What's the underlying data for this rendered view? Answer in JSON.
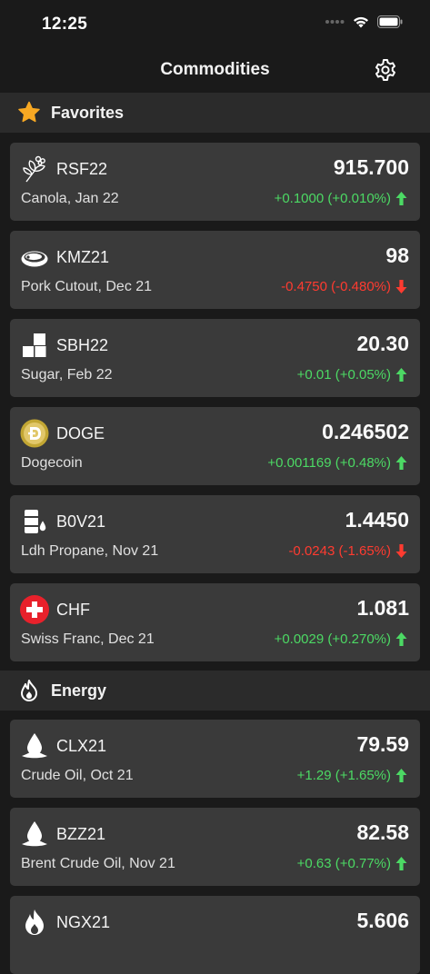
{
  "status": {
    "time": "12:25"
  },
  "nav": {
    "title": "Commodities"
  },
  "sections": [
    {
      "title": "Favorites"
    },
    {
      "title": "Energy"
    }
  ],
  "cards": [
    {
      "symbol": "RSF22",
      "name": "Canola, Jan 22",
      "price": "915.700",
      "change": "+0.1000 (+0.010%)",
      "direction": "up",
      "icon": "canola-leaf-icon"
    },
    {
      "symbol": "KMZ21",
      "name": "Pork Cutout, Dec 21",
      "price": "98",
      "change": "-0.4750 (-0.480%)",
      "direction": "down",
      "icon": "meat-icon"
    },
    {
      "symbol": "SBH22",
      "name": "Sugar, Feb 22",
      "price": "20.30",
      "change": "+0.01 (+0.05%)",
      "direction": "up",
      "icon": "sugar-cubes-icon"
    },
    {
      "symbol": "DOGE",
      "name": "Dogecoin",
      "price": "0.246502",
      "change": "+0.001169 (+0.48%)",
      "direction": "up",
      "icon": "dogecoin-icon"
    },
    {
      "symbol": "B0V21",
      "name": "Ldh Propane, Nov 21",
      "price": "1.4450",
      "change": "-0.0243 (-1.65%)",
      "direction": "down",
      "icon": "propane-barrel-icon"
    },
    {
      "symbol": "CHF",
      "name": "Swiss Franc, Dec 21",
      "price": "1.081",
      "change": "+0.0029 (+0.270%)",
      "direction": "up",
      "icon": "swiss-flag-icon"
    },
    {
      "symbol": "CLX21",
      "name": "Crude Oil, Oct 21",
      "price": "79.59",
      "change": "+1.29 (+1.65%)",
      "direction": "up",
      "icon": "oil-drop-icon"
    },
    {
      "symbol": "BZZ21",
      "name": "Brent Crude Oil, Nov 21",
      "price": "82.58",
      "change": "+0.63 (+0.77%)",
      "direction": "up",
      "icon": "oil-drop-icon"
    },
    {
      "symbol": "NGX21",
      "name": "",
      "price": "5.606",
      "change": "",
      "direction": "up",
      "icon": "flame-icon"
    }
  ],
  "colors": {
    "up": "#4cd964",
    "down": "#ff3b30",
    "card": "#3a3a3a",
    "section": "#2b2b2b",
    "background": "#1a1a1a"
  }
}
